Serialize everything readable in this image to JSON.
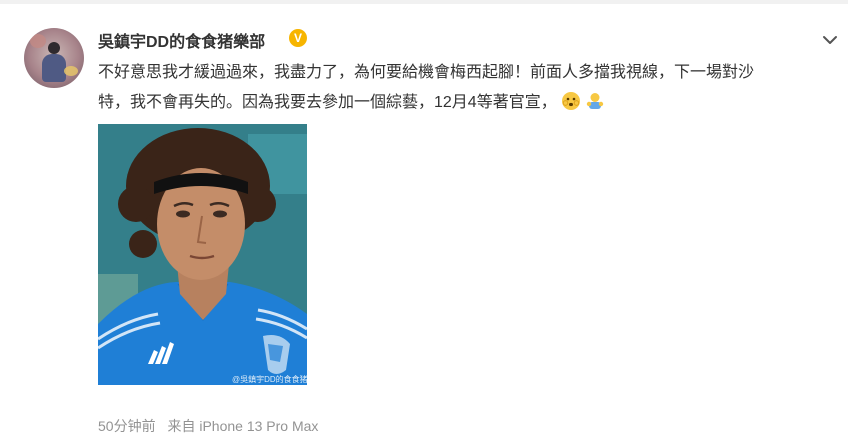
{
  "post": {
    "username": "吳鎮宇DD的食食猪樂部",
    "verified_icon": "verified-badge-icon",
    "text_line1": "不好意思我才緩過過來，我盡力了，為何要給機會梅西起腳！前面人多擋我視線，下一場對沙",
    "text_line2": "特，我不會再失的。因為我要去參加一個綜藝，12月4等著官宣，",
    "emojis": [
      "embarrassed-face-icon",
      "hug-emoji-icon"
    ],
    "photo_watermark": "@吳鎮宇DD的食食猪樂部",
    "time": "50分钟前",
    "source": "来自 iPhone 13 Pro Max"
  },
  "colors": {
    "username": "#333333",
    "body_text": "#333333",
    "meta_text": "#939393",
    "verified": "#f7b500",
    "jersey": "#1f7fd6"
  }
}
